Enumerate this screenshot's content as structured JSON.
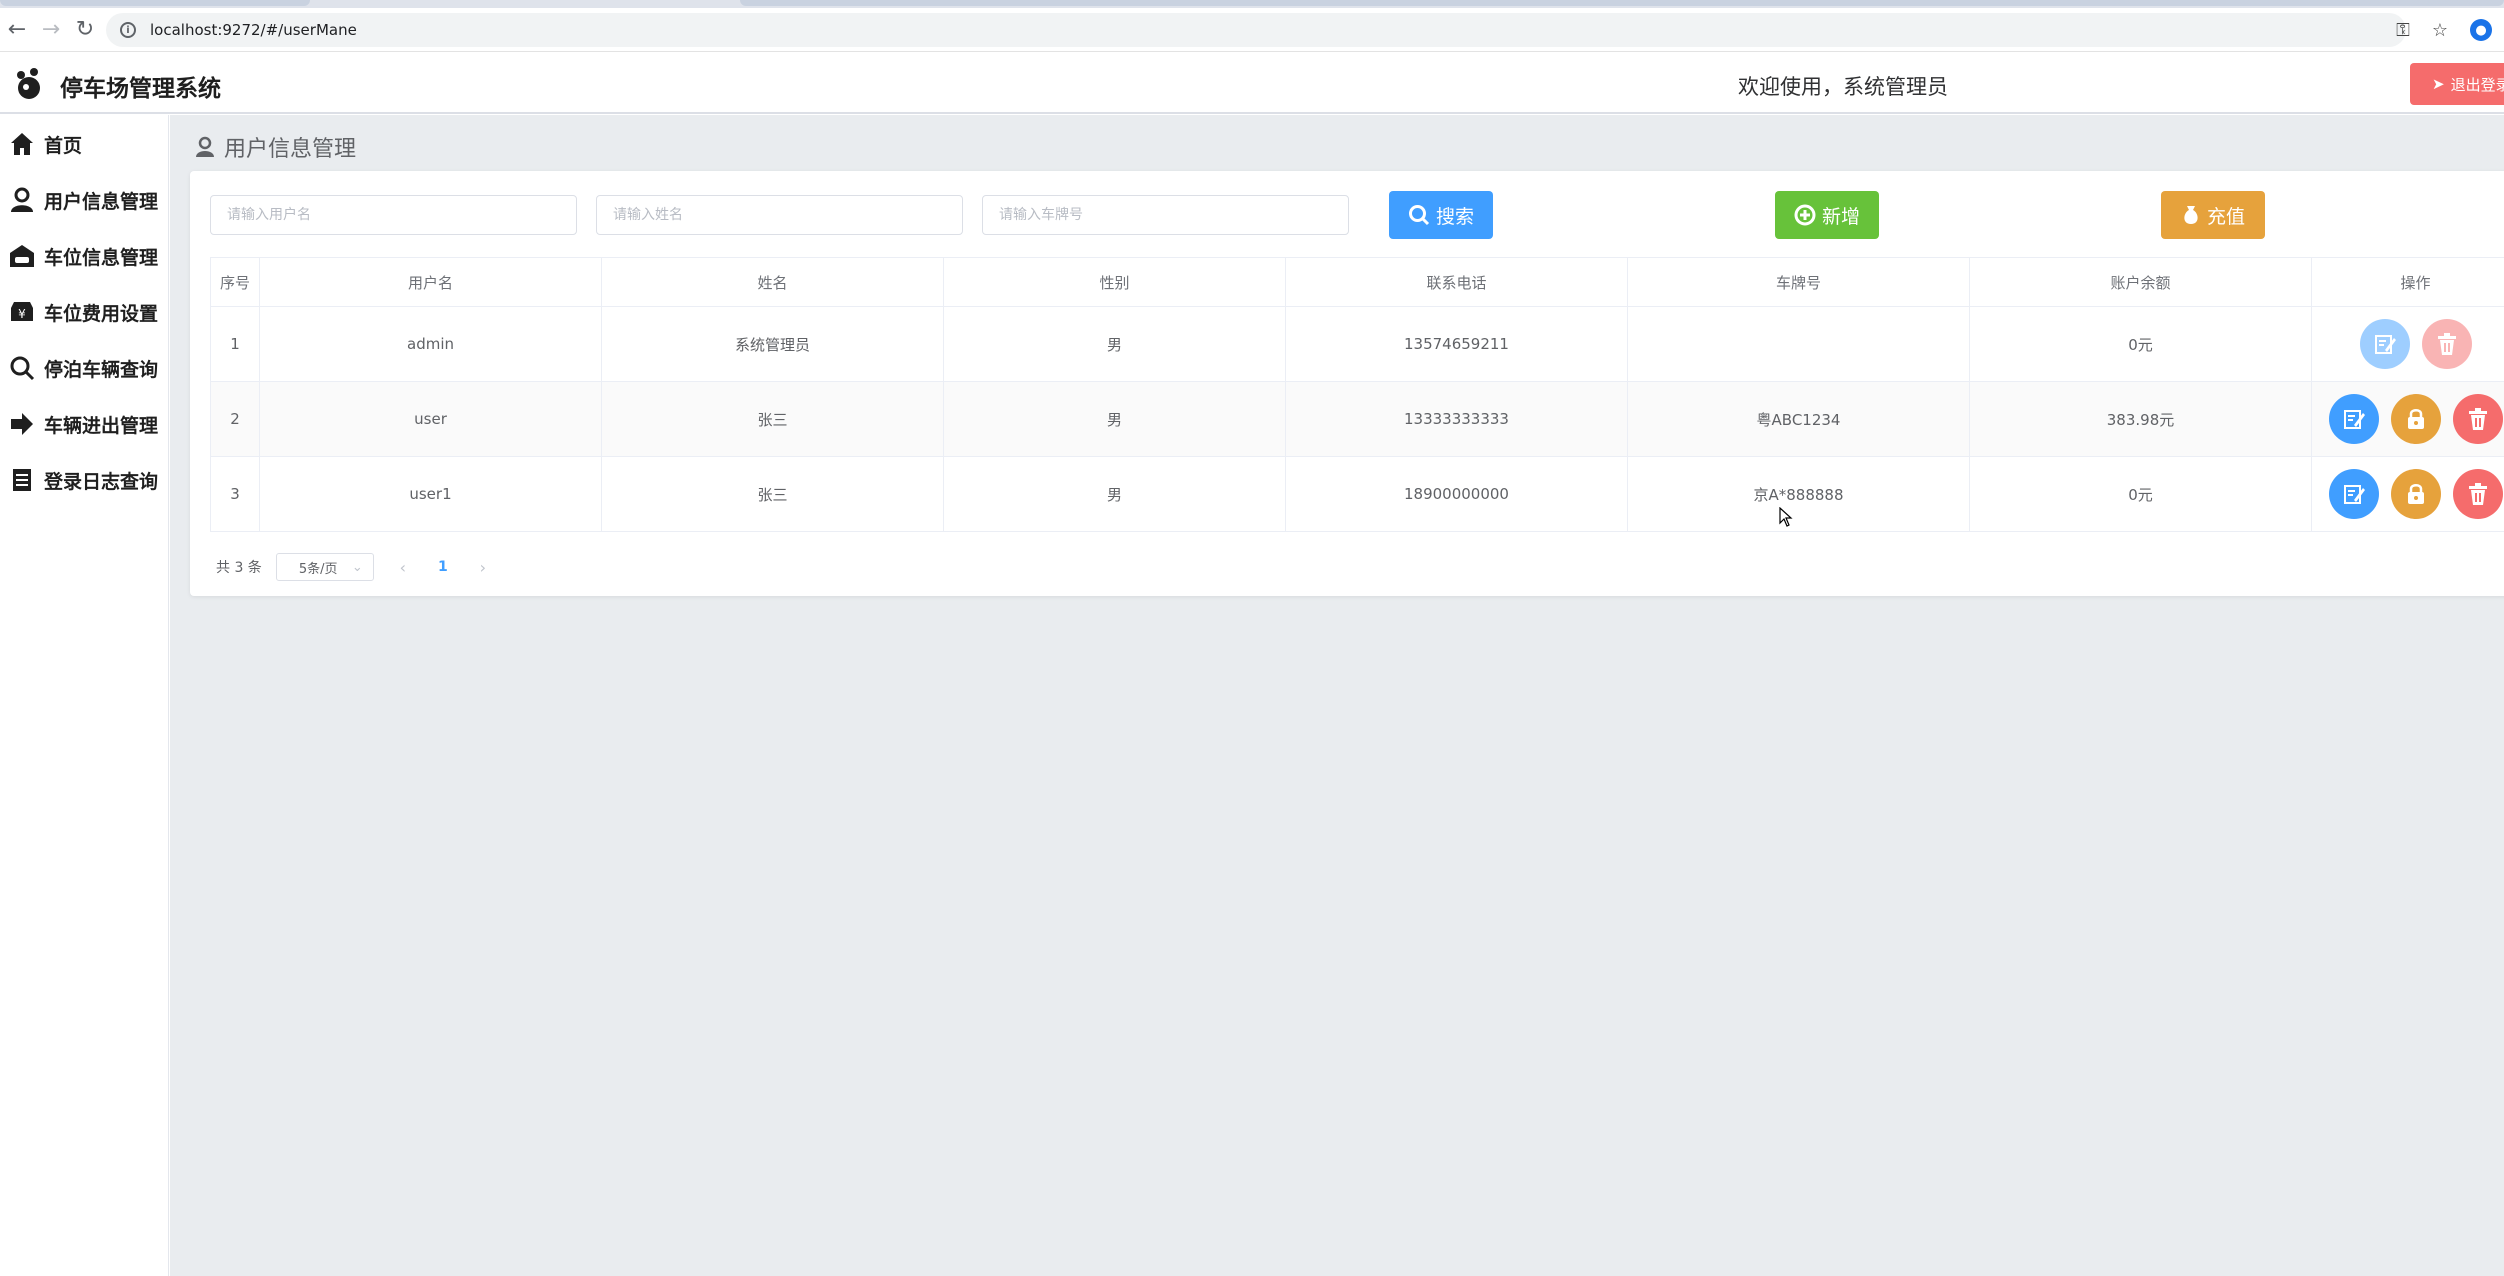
{
  "browser": {
    "url": "localhost:9272/#/userMane",
    "back_icon": "arrow-left-icon",
    "forward_icon": "arrow-right-icon",
    "reload_icon": "reload-icon"
  },
  "header": {
    "app_title": "停车场管理系统",
    "welcome": "欢迎使用，系统管理员",
    "logout_label": "退出登录"
  },
  "sidebar": {
    "items": [
      {
        "label": "首页",
        "icon": "home-icon"
      },
      {
        "label": "用户信息管理",
        "icon": "user-icon"
      },
      {
        "label": "车位信息管理",
        "icon": "garage-icon"
      },
      {
        "label": "车位费用设置",
        "icon": "fee-icon"
      },
      {
        "label": "停泊车辆查询",
        "icon": "search-icon"
      },
      {
        "label": "车辆进出管理",
        "icon": "arrow-in-out-icon"
      },
      {
        "label": "登录日志查询",
        "icon": "log-icon"
      }
    ]
  },
  "page": {
    "breadcrumb": "用户信息管理"
  },
  "search": {
    "username_placeholder": "请输入用户名",
    "name_placeholder": "请输入姓名",
    "plate_placeholder": "请输入车牌号",
    "search_label": "搜索",
    "add_label": "新增",
    "recharge_label": "充值"
  },
  "table": {
    "headers": [
      "序号",
      "用户名",
      "姓名",
      "性别",
      "联系电话",
      "车牌号",
      "账户余额",
      "操作"
    ],
    "rows": [
      {
        "index": "1",
        "username": "admin",
        "name": "系统管理员",
        "gender": "男",
        "phone": "13574659211",
        "plate": "",
        "balance": "0元"
      },
      {
        "index": "2",
        "username": "user",
        "name": "张三",
        "gender": "男",
        "phone": "13333333333",
        "plate": "粤ABC1234",
        "balance": "383.98元"
      },
      {
        "index": "3",
        "username": "user1",
        "name": "张三",
        "gender": "男",
        "phone": "18900000000",
        "plate": "京A*888888",
        "balance": "0元"
      }
    ]
  },
  "pagination": {
    "total": "共 3 条",
    "page_size": "5条/页",
    "current_page": "1"
  },
  "colors": {
    "primary": "#409eff",
    "success": "#67c23a",
    "warning": "#e6a23c",
    "danger": "#f56c6c"
  }
}
